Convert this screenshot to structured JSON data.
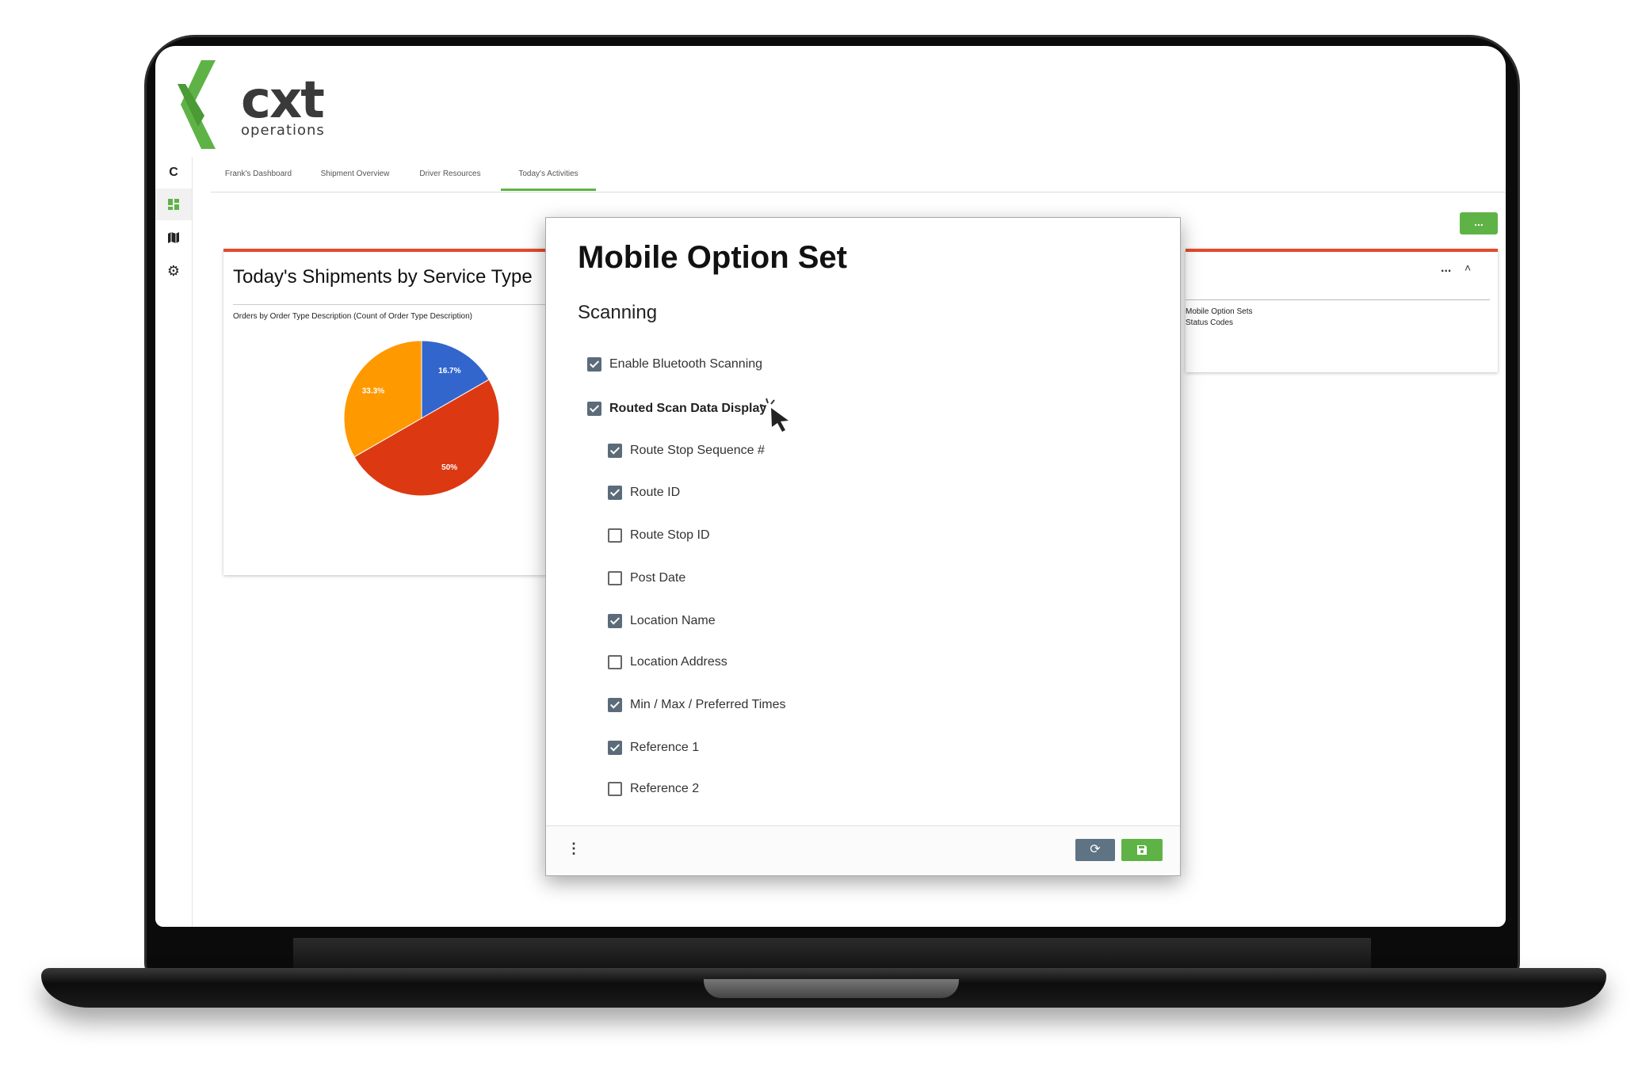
{
  "brand": {
    "logo_text": "cxt",
    "logo_sub": "operations",
    "accent": "#5fb346",
    "x_color": "#5fb346"
  },
  "sidebar": {
    "items": [
      {
        "icon": "c-letter-icon",
        "label": "C"
      },
      {
        "icon": "dashboard-icon"
      },
      {
        "icon": "map-icon"
      },
      {
        "icon": "gear-icon"
      }
    ]
  },
  "tabs": [
    {
      "label": "Frank's Dashboard"
    },
    {
      "label": "Shipment Overview"
    },
    {
      "label": "Driver Resources"
    },
    {
      "label": "Today's Activities"
    }
  ],
  "toolbar": {
    "more_label": "..."
  },
  "left_card": {
    "title": "Today's Shipments by Service Type",
    "subtitle": "Orders by Order Type Description (Count of Order Type Description)"
  },
  "right_card": {
    "more_label": "...",
    "links": [
      "Mobile Option Sets",
      "Status Codes"
    ]
  },
  "chart_data": {
    "type": "pie",
    "slices": [
      {
        "value": 16.7,
        "label": "16.7%",
        "color": "#3366cc"
      },
      {
        "value": 50,
        "label": "50%",
        "color": "#dc3912"
      },
      {
        "value": 33.3,
        "label": "33.3%",
        "color": "#ff9900"
      }
    ]
  },
  "modal": {
    "title": "Mobile Option Set",
    "section": "Scanning",
    "options": [
      {
        "label": "Enable Bluetooth Scanning",
        "checked": true,
        "bold": false,
        "indent": 0
      },
      {
        "label": "Routed Scan Data Display",
        "checked": true,
        "bold": true,
        "indent": 0
      },
      {
        "label": "Route Stop Sequence #",
        "checked": true,
        "bold": false,
        "indent": 1
      },
      {
        "label": "Route ID",
        "checked": true,
        "bold": false,
        "indent": 1
      },
      {
        "label": "Route Stop ID",
        "checked": false,
        "bold": false,
        "indent": 1
      },
      {
        "label": "Post Date",
        "checked": false,
        "bold": false,
        "indent": 1
      },
      {
        "label": "Location Name",
        "checked": true,
        "bold": false,
        "indent": 1
      },
      {
        "label": "Location Address",
        "checked": false,
        "bold": false,
        "indent": 1
      },
      {
        "label": "Min / Max / Preferred Times",
        "checked": true,
        "bold": false,
        "indent": 1
      },
      {
        "label": "Reference 1",
        "checked": true,
        "bold": false,
        "indent": 1
      },
      {
        "label": "Reference 2",
        "checked": false,
        "bold": false,
        "indent": 1
      }
    ],
    "footer": {
      "menu_icon": "kebab-icon",
      "reset_icon": "reset-icon",
      "save_icon": "save-icon"
    }
  }
}
